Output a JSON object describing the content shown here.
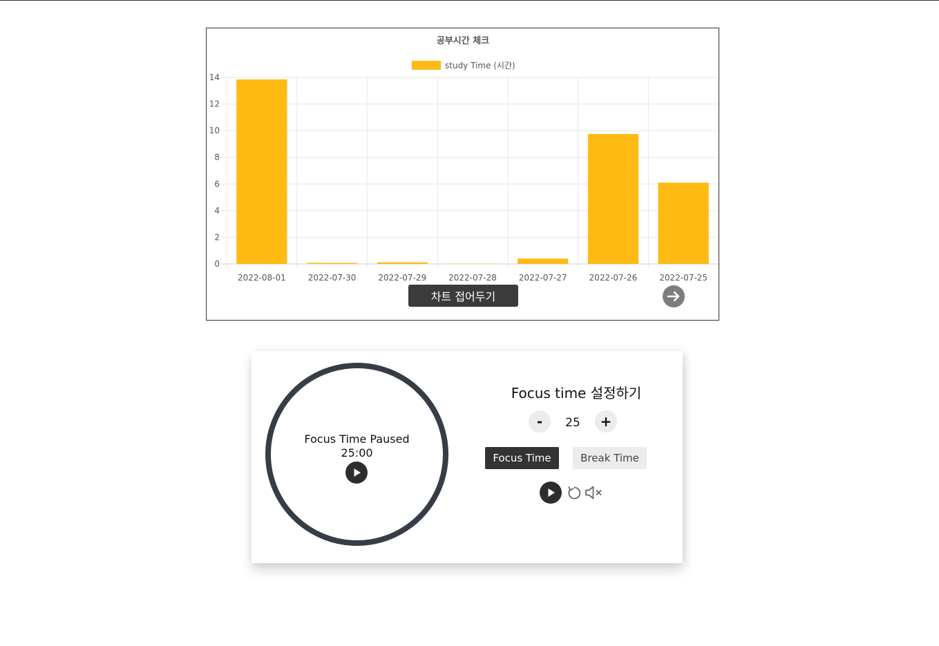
{
  "chart_data": {
    "type": "bar",
    "title": "공부시간 체크",
    "legend": "study Time (시간)",
    "legend_position": "top",
    "categories": [
      "2022-08-01",
      "2022-07-30",
      "2022-07-29",
      "2022-07-28",
      "2022-07-27",
      "2022-07-26",
      "2022-07-25"
    ],
    "series": [
      {
        "name": "study Time (시간)",
        "values": [
          13.85,
          0.08,
          0.12,
          0.02,
          0.4,
          9.75,
          6.1
        ]
      }
    ],
    "ylim": [
      0,
      14
    ],
    "yticks": [
      "0",
      "2",
      "4",
      "6",
      "8",
      "10",
      "12",
      "14"
    ],
    "grid": true,
    "color": "#ffba14"
  },
  "chart_controls": {
    "collapse_label": "차트 접어두기",
    "next_icon": "arrow-right-icon"
  },
  "timer": {
    "status": "Focus Time Paused",
    "time": "25:00",
    "play_icon": "play-icon",
    "ring_color": "#373d47"
  },
  "settings": {
    "title": "Focus time 설정하기",
    "minus_label": "-",
    "plus_label": "+",
    "value": "25",
    "focus_label": "Focus Time",
    "break_label": "Break Time",
    "controls": [
      "play-icon",
      "reset-icon",
      "mute-icon"
    ]
  }
}
